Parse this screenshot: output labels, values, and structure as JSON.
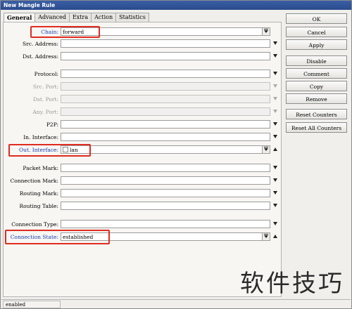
{
  "window": {
    "title": "New Mangle Rule"
  },
  "tabs": [
    "General",
    "Advanced",
    "Extra",
    "Action",
    "Statistics"
  ],
  "fields": {
    "chain": {
      "label": "Chain:",
      "value": "forward"
    },
    "src_address": {
      "label": "Src. Address:",
      "value": ""
    },
    "dst_address": {
      "label": "Dst. Address:",
      "value": ""
    },
    "protocol": {
      "label": "Protocol:",
      "value": ""
    },
    "src_port": {
      "label": "Src. Port:",
      "value": ""
    },
    "dst_port": {
      "label": "Dst. Port:",
      "value": ""
    },
    "any_port": {
      "label": "Any. Port:",
      "value": ""
    },
    "p2p": {
      "label": "P2P:",
      "value": ""
    },
    "in_interface": {
      "label": "In. Interface:",
      "value": ""
    },
    "out_interface": {
      "label": "Out. Interface:",
      "value": "lan"
    },
    "packet_mark": {
      "label": "Packet Mark:",
      "value": ""
    },
    "connection_mark": {
      "label": "Connection Mark:",
      "value": ""
    },
    "routing_mark": {
      "label": "Routing Mark:",
      "value": ""
    },
    "routing_table": {
      "label": "Routing Table:",
      "value": ""
    },
    "connection_type": {
      "label": "Connection Type:",
      "value": ""
    },
    "connection_state": {
      "label": "Connection State:",
      "value": "established"
    }
  },
  "buttons": {
    "ok": "OK",
    "cancel": "Cancel",
    "apply": "Apply",
    "disable": "Disable",
    "comment": "Comment",
    "copy": "Copy",
    "remove": "Remove",
    "reset_counters": "Reset Counters",
    "reset_all_counters": "Reset All Counters"
  },
  "status": {
    "state": "enabled"
  },
  "watermark": "软件技巧",
  "colors": {
    "highlight_box": "#e02b1f",
    "title_bar": "#2b4b8c",
    "label_highlight": "#1a3fb0"
  }
}
